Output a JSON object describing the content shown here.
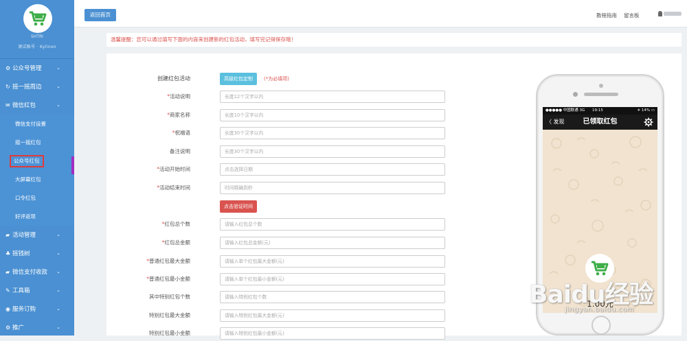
{
  "sidebar": {
    "profile": {
      "name": "SHTRI",
      "desc": "测试账号 · Kylinon"
    },
    "items": [
      {
        "label": "公众号管理",
        "icon": "gear-icon",
        "chevron": "⌄"
      },
      {
        "label": "摇一摇周边",
        "icon": "refresh-icon",
        "chevron": "⌄"
      },
      {
        "label": "微信红包",
        "icon": "envelope-icon",
        "chevron": "⌄"
      },
      {
        "label": "微信支付设置"
      },
      {
        "label": "摇一摇红包"
      },
      {
        "label": "公众号红包"
      },
      {
        "label": "大屏幕红包"
      },
      {
        "label": "口令红包"
      },
      {
        "label": "好评返现"
      },
      {
        "label": "活动管理",
        "icon": "folder-icon",
        "chevron": "⌄"
      },
      {
        "label": "摇钱树",
        "icon": "tree-icon",
        "chevron": "⌄"
      },
      {
        "label": "微信支付收款",
        "icon": "folder-icon",
        "chevron": "⌄"
      },
      {
        "label": "工具箱",
        "icon": "wrench-icon",
        "chevron": "⌄"
      },
      {
        "label": "服务订购",
        "icon": "globe-icon",
        "chevron": "⌄"
      },
      {
        "label": "推广",
        "icon": "gear-icon",
        "chevron": "⌄"
      }
    ]
  },
  "topbar": {
    "home_button": "返回首页",
    "link_guide": "教程指南",
    "link_message": "留言板"
  },
  "notice": "温馨提醒：您可以通过填写下面的内容来创建新的红包活动，填写完记得保存哦！",
  "form": {
    "title_label": "创建红包活动",
    "custom_button": "高级红包定制",
    "required_hint": "(*为必填项)",
    "verify_button": "点击验证时间",
    "fields": [
      {
        "label": "活动说明",
        "required": "*",
        "placeholder": "长度12个汉字以内"
      },
      {
        "label": "商家名称",
        "required": "*",
        "placeholder": "长度10个汉字以内"
      },
      {
        "label": "祝福语",
        "required": "*",
        "placeholder": "长度30个汉字以内"
      },
      {
        "label": "备注说明",
        "required": "",
        "placeholder": "长度30个汉字以内"
      },
      {
        "label": "活动开始时间",
        "required": "*",
        "placeholder": "点击选择日期"
      },
      {
        "label": "活动结束时间",
        "required": "*",
        "placeholder": "时间精确到秒"
      },
      {
        "label": "红包总个数",
        "required": "*",
        "placeholder": "请输入红包总个数"
      },
      {
        "label": "红包总金额",
        "required": "*",
        "placeholder": "请输入红包总金额(元)"
      },
      {
        "label": "普通红包最大金额",
        "required": "*",
        "placeholder": "请输入单个红包最大金额(元)"
      },
      {
        "label": "普通红包最小金额",
        "required": "*",
        "placeholder": "请输入单个红包最小金额(元)"
      },
      {
        "label": "其中特别红包个数",
        "required": "",
        "placeholder": "请输入特别红包个数"
      },
      {
        "label": "特别红包最大金额",
        "required": "",
        "placeholder": "请输入特别红包最大金额(元)"
      },
      {
        "label": "特别红包最小金额",
        "required": "",
        "placeholder": "请输入特别红包最小金额(元)"
      }
    ]
  },
  "phone": {
    "carrier": "●●●●● 中国联通  3G",
    "time": "19:15",
    "battery": "✈ 14% ▭",
    "back": "〈 发现",
    "title": "已领取红包",
    "amount": "1.00元"
  },
  "watermark": {
    "main": "Baidu经验",
    "sub": "jingyan.baidu.com"
  },
  "colors": {
    "sidebar": "#4a90d2",
    "danger": "#d9534f",
    "info": "#5bc0de",
    "highlight": "#e23a3a"
  }
}
